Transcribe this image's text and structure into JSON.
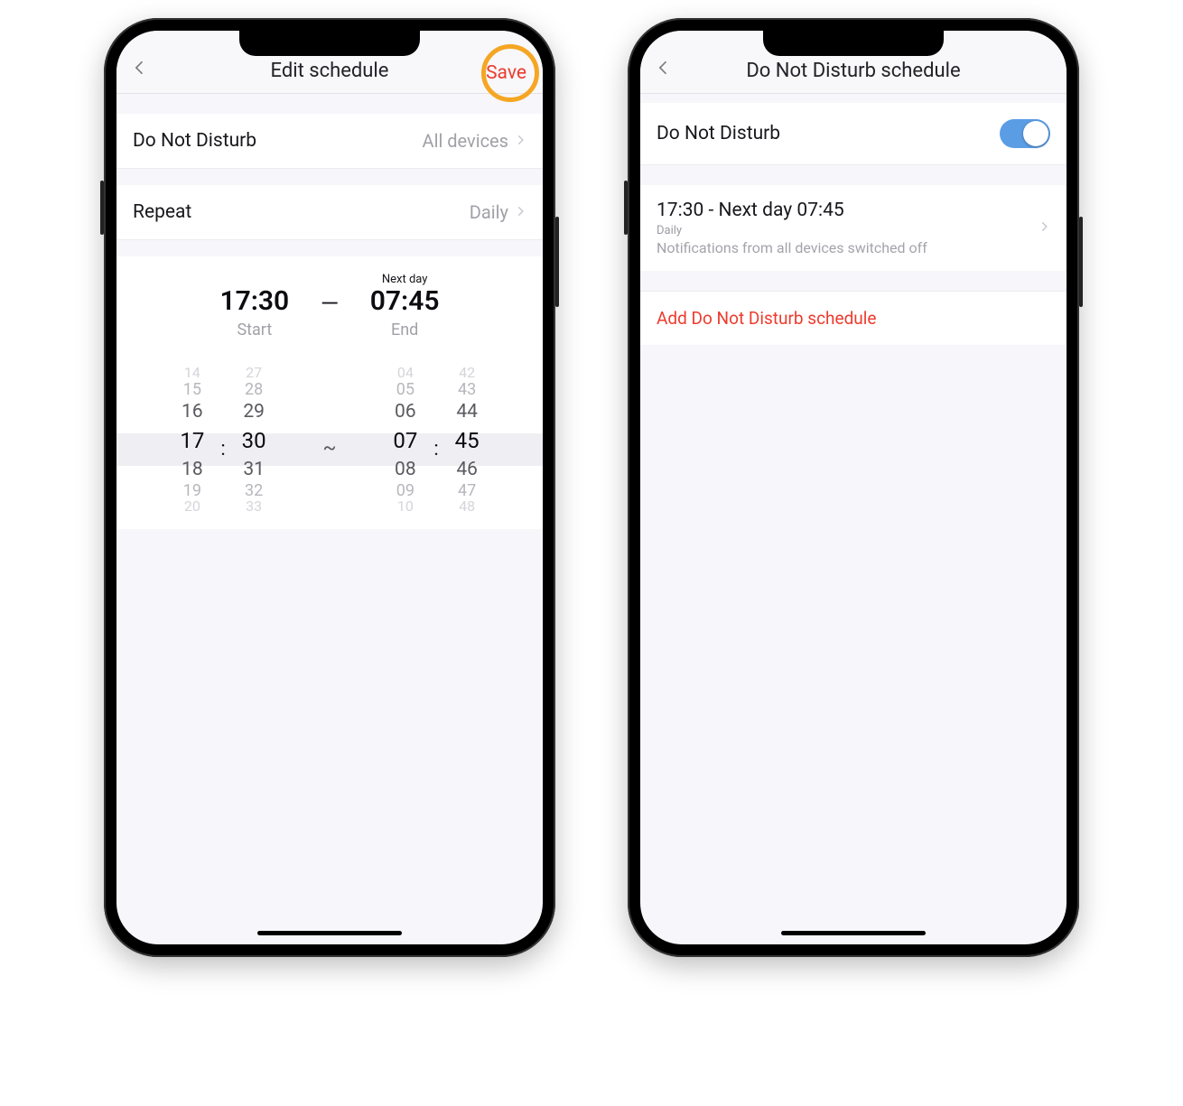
{
  "left": {
    "header": {
      "title": "Edit schedule",
      "save_label": "Save"
    },
    "dnd_row": {
      "label": "Do Not Disturb",
      "value": "All devices"
    },
    "repeat_row": {
      "label": "Repeat",
      "value": "Daily"
    },
    "time": {
      "start": "17:30",
      "start_sub": "Start",
      "end_prefix": "Next day",
      "end": "07:45",
      "end_sub": "End",
      "dash": "—"
    },
    "picker": {
      "left_hour": [
        "14",
        "15",
        "16",
        "17",
        "18",
        "19",
        "20"
      ],
      "left_min": [
        "27",
        "28",
        "29",
        "30",
        "31",
        "32",
        "33"
      ],
      "right_hour": [
        "04",
        "05",
        "06",
        "07",
        "08",
        "09",
        "10"
      ],
      "right_min": [
        "42",
        "43",
        "44",
        "45",
        "46",
        "47",
        "48"
      ],
      "colon": ":",
      "tilde": "~"
    }
  },
  "right": {
    "header": {
      "title": "Do Not Disturb schedule"
    },
    "dnd_toggle": {
      "label": "Do Not Disturb"
    },
    "schedule": {
      "time": "17:30 - Next day 07:45",
      "daily": "Daily",
      "desc": "Notifications from all devices switched off"
    },
    "add_label": "Add Do Not Disturb schedule"
  }
}
